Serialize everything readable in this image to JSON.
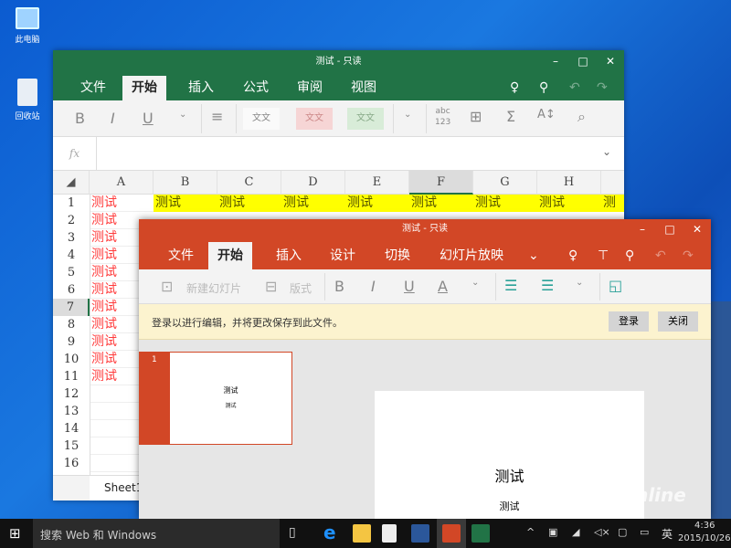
{
  "desktop": {
    "icons": [
      {
        "label": "此电脑",
        "name": "this-pc-icon"
      },
      {
        "label": "回收站",
        "name": "recycle-bin-icon"
      }
    ]
  },
  "excel": {
    "title": "测试 - 只读",
    "accent": "#217346",
    "tabs": [
      "文件",
      "开始",
      "插入",
      "公式",
      "审阅",
      "视图"
    ],
    "active_tab": "开始",
    "ribbon": {
      "bold": "B",
      "italic": "I",
      "underline": "U",
      "style1": "文文",
      "style2": "文文",
      "style3": "文文",
      "abc": "abc",
      "n123": "123",
      "sum": "Σ"
    },
    "fx": "fx",
    "columns": [
      "A",
      "B",
      "C",
      "D",
      "E",
      "F",
      "G",
      "H"
    ],
    "selected_column": "F",
    "selected_row": "7",
    "rows": [
      "1",
      "2",
      "3",
      "4",
      "5",
      "6",
      "7",
      "8",
      "9",
      "10",
      "11",
      "12",
      "13",
      "14",
      "15",
      "16"
    ],
    "cell_text": "测试",
    "sheet_tab": "Sheet1"
  },
  "ppt": {
    "title": "测试 - 只读",
    "accent": "#d24726",
    "tabs": [
      "文件",
      "开始",
      "插入",
      "设计",
      "切换",
      "幻灯片放映"
    ],
    "active_tab": "开始",
    "ribbon": {
      "new_slide": "新建幻灯片",
      "layout": "版式",
      "bold": "B",
      "italic": "I",
      "underline": "U",
      "font_color": "A"
    },
    "message": "登录以进行编辑，并将更改保存到此文件。",
    "login_button": "登录",
    "close_button": "关闭",
    "slide_number": "1",
    "slide_title": "测试",
    "slide_subtitle": "测试"
  },
  "taskbar": {
    "search_placeholder": "搜索 Web 和 Windows",
    "time": "4:36",
    "date": "2015/10/26",
    "ime": "英"
  },
  "watermark": "PConline"
}
